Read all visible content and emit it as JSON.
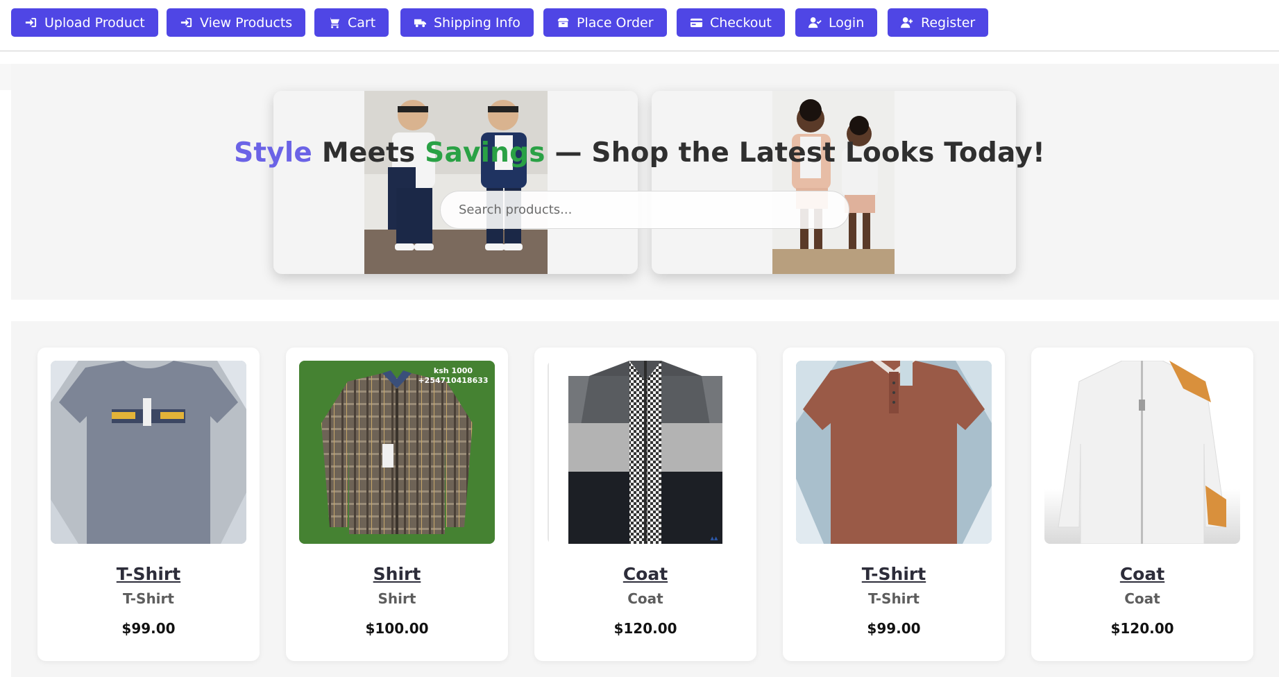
{
  "nav": {
    "items": [
      {
        "label": "Upload Product",
        "icon": "sign-in-icon"
      },
      {
        "label": "View Products",
        "icon": "sign-in-icon"
      },
      {
        "label": "Cart",
        "icon": "cart-icon"
      },
      {
        "label": "Shipping Info",
        "icon": "shipping-icon"
      },
      {
        "label": "Place Order",
        "icon": "box-open-icon"
      },
      {
        "label": "Checkout",
        "icon": "credit-card-icon"
      },
      {
        "label": "Login",
        "icon": "user-check-icon"
      },
      {
        "label": "Register",
        "icon": "user-plus-icon"
      }
    ]
  },
  "hero": {
    "title_word1": "Style",
    "title_word2": " Meets ",
    "title_word3": "Savings",
    "title_rest": " — Shop the Latest Looks Today!",
    "search_placeholder": "Search products..."
  },
  "products": [
    {
      "name": "T-Shirt",
      "category": "T-Shirt",
      "price": "$99.00",
      "image": "grey-tshirt"
    },
    {
      "name": "Shirt",
      "category": "Shirt",
      "price": "$100.00",
      "image": "plaid-shirt",
      "image_text": [
        "ksh 1000",
        "+254710418633"
      ]
    },
    {
      "name": "Coat",
      "category": "Coat",
      "price": "$120.00",
      "image": "knit-cardigan"
    },
    {
      "name": "T-Shirt",
      "category": "T-Shirt",
      "price": "$99.00",
      "image": "brown-polo"
    },
    {
      "name": "Coat",
      "category": "Coat",
      "price": "$120.00",
      "image": "white-zip-sweater"
    }
  ],
  "colors": {
    "accent": "#4f46e5",
    "title_style": "#6b63e6",
    "title_savings": "#2aa145"
  }
}
